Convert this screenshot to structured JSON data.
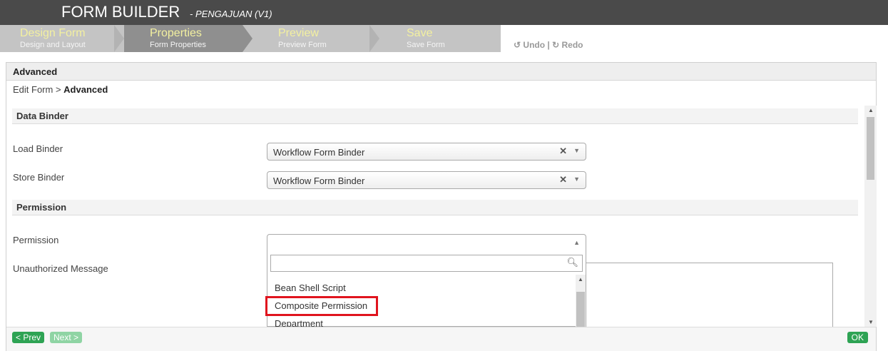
{
  "header": {
    "title": "FORM BUILDER",
    "subtitle": "- PENGAJUAN (V1)"
  },
  "steps": [
    {
      "label": "Design Form",
      "sub": "Design and Layout"
    },
    {
      "label": "Properties",
      "sub": "Form Properties"
    },
    {
      "label": "Preview",
      "sub": "Preview Form"
    },
    {
      "label": "Save",
      "sub": "Save Form"
    }
  ],
  "toolbar": {
    "undo": "Undo",
    "sep": "|",
    "redo": "Redo"
  },
  "panel": {
    "title": "Advanced",
    "breadcrumb_prefix": "Edit Form >",
    "breadcrumb_current": "Advanced"
  },
  "data_binder": {
    "section_title": "Data Binder",
    "load_label": "Load Binder",
    "load_value": "Workflow Form Binder",
    "store_label": "Store Binder",
    "store_value": "Workflow Form Binder"
  },
  "permission": {
    "section_title": "Permission",
    "permission_label": "Permission",
    "unauthorized_label": "Unauthorized Message",
    "search_placeholder": "",
    "options": [
      "Bean Shell Script",
      "Composite Permission",
      "Department"
    ]
  },
  "footer": {
    "prev": "< Prev",
    "next": "Next >",
    "ok": "OK"
  }
}
